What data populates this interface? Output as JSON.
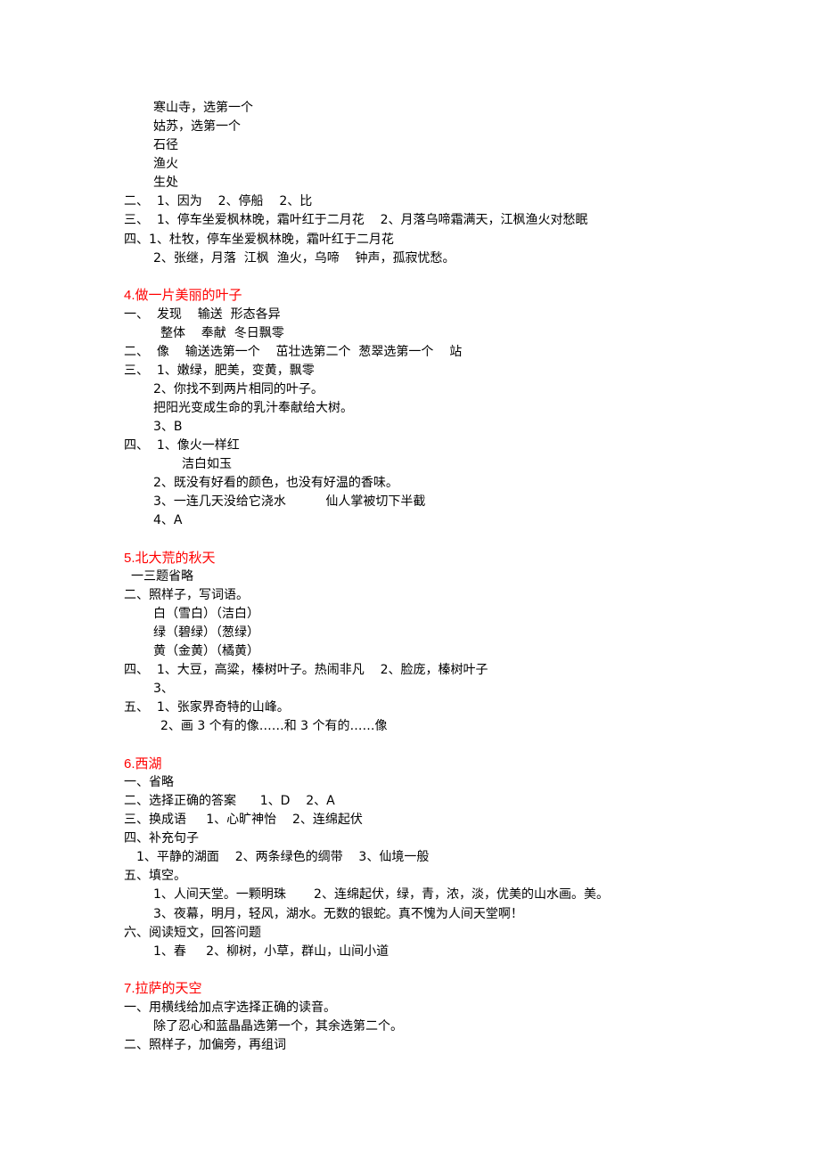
{
  "accent_color": "#ff0000",
  "sections": [
    {
      "id": "s3",
      "title": null,
      "lines": [
        "寒山寺，选第一个",
        "姑苏，选第一个",
        "石径",
        "渔火",
        "生处",
        "二、  1、因为    2、停船    2、比",
        "三、  1、停车坐爱枫林晚，霜叶红于二月花    2、月落乌啼霜满天，江枫渔火对愁眠",
        "四、1、杜牧，停车坐爱枫林晚，霜叶红于二月花",
        "2、张继，月落  江枫  渔火，乌啼    钟声，孤寂忧愁。"
      ]
    },
    {
      "id": "s4",
      "title": "4.做一片美丽的叶子",
      "lines": [
        "一、  发现    输送  形态各异",
        "整体    奉献  冬日飘零",
        "二、  像    输送选第一个    茁壮选第二个  葱翠选第一个    站",
        "三、  1、嫩绿，肥美，变黄，飘零",
        "2、你找不到两片相同的叶子。",
        "把阳光变成生命的乳汁奉献给大树。",
        "3、B",
        "四、  1、像火一样红",
        "洁白如玉",
        "2、既没有好看的颜色，也没有好温的香味。",
        "3、一连几天没给它浇水          仙人掌被切下半截",
        "4、A"
      ]
    },
    {
      "id": "s5",
      "title": "5.北大荒的秋天",
      "lines": [
        "一三题省略",
        "二、照样子，写词语。",
        "白（雪白）（洁白）",
        "绿（碧绿）（葱绿）",
        "黄（金黄）（橘黄）",
        "四、  1、大豆，高粱，榛树叶子。热闹非凡    2、脸庞，榛树叶子",
        "3、",
        "五、  1、张家界奇特的山峰。",
        "2、画 3 个有的像……和 3 个有的……像"
      ]
    },
    {
      "id": "s6",
      "title": "6.西湖",
      "lines": [
        "一、省略",
        "二、选择正确的答案      1、D    2、A",
        "三、换成语     1、心旷神怡    2、连绵起伏",
        "四、补充句子",
        "1、平静的湖面    2、两条绿色的绸带    3、仙境一般",
        "五、填空。",
        "1、人间天堂。一颗明珠       2、连绵起伏，绿，青，浓，淡，优美的山水画。美。",
        "3、夜幕，明月，轻风，湖水。无数的银蛇。真不愧为人间天堂啊！",
        "六、阅读短文，回答问题",
        "1、春     2、柳树，小草，群山，山间小道"
      ]
    },
    {
      "id": "s7",
      "title": "7.拉萨的天空",
      "lines": [
        "一、用横线给加点字选择正确的读音。",
        "除了忍心和蓝晶晶选第一个，其余选第二个。",
        "二、照样子，加偏旁，再组词"
      ]
    }
  ]
}
